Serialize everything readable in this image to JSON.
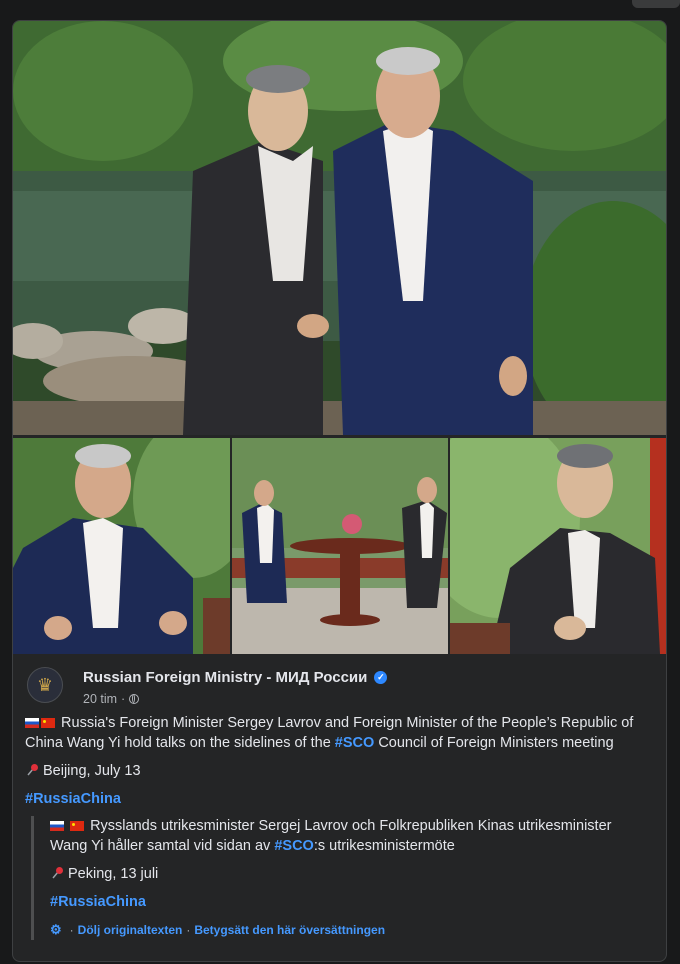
{
  "post": {
    "author": "Russian Foreign Ministry - МИД России",
    "time": "20 tim",
    "time_sep": "·",
    "text_main": "Russia's Foreign Minister Sergey Lavrov and Foreign Minister of the People’s Republic of China Wang Yi hold talks on the sidelines of the",
    "text_hashtag_sco": "#SCO",
    "text_end": "Council of Foreign Ministers meeting",
    "location": "Beijing, July 13",
    "hashtag": "#RussiaChina"
  },
  "translation": {
    "text_main": "Rysslands utrikesminister Sergej Lavrov och Folkrepubliken Kinas utrikesminister Wang Yi håller samtal vid sidan av",
    "text_hashtag_sco": "#SCO",
    "text_end": ":s utrikesministermöte",
    "location": "Peking, 13 juli",
    "hashtag": "#RussiaChina",
    "hide_original": "Dölj originaltexten",
    "rate": "Betygsätt den här översättningen",
    "sep": "·"
  },
  "colors": {
    "link": "#4599ff",
    "verified": "#2d88ff",
    "background": "#18191a",
    "card": "#242526"
  },
  "icons": [
    "verified-badge-icon",
    "globe-icon",
    "pin-icon",
    "translate-gear-icon"
  ]
}
